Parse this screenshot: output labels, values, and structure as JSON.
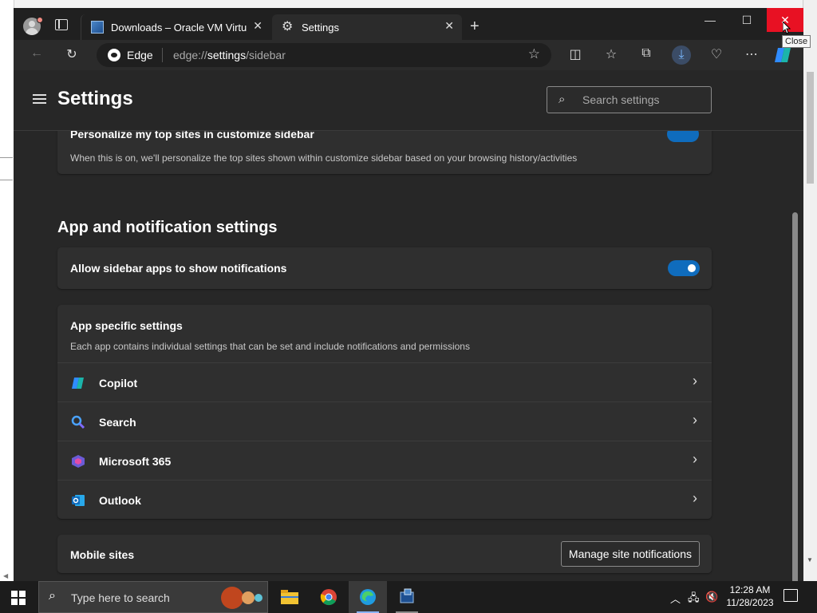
{
  "browser": {
    "tabs": [
      {
        "label": "Downloads – Oracle VM VirtualBox",
        "close": "✕"
      },
      {
        "label": "Settings",
        "close": "✕"
      }
    ],
    "new_tab": "+",
    "window": {
      "minimize": "—",
      "maximize": "☐",
      "close": "✕",
      "close_tooltip": "Close"
    },
    "address": {
      "site_label": "Edge",
      "url_prefix": "edge://",
      "url_main": "settings",
      "url_suffix": "/sidebar"
    }
  },
  "settings": {
    "title": "Settings",
    "search_placeholder": "Search settings",
    "partial_card": {
      "title": "Personalize my top sites in customize sidebar",
      "description": "When this is on, we'll personalize the top sites shown within customize sidebar based on your browsing history/activities"
    },
    "section_title": "App and notification settings",
    "notifications_toggle": {
      "label": "Allow sidebar apps to show notifications",
      "on": true
    },
    "app_specific": {
      "title": "App specific settings",
      "description": "Each app contains individual settings that can be set and include notifications and permissions",
      "apps": [
        {
          "label": "Copilot",
          "icon": "copilot-icon"
        },
        {
          "label": "Search",
          "icon": "search-icon"
        },
        {
          "label": "Microsoft 365",
          "icon": "microsoft-365-icon"
        },
        {
          "label": "Outlook",
          "icon": "outlook-icon"
        }
      ]
    },
    "mobile_sites": {
      "label": "Mobile sites",
      "button": "Manage site notifications"
    }
  },
  "taskbar": {
    "search_placeholder": "Type here to search",
    "time": "12:28 AM",
    "date": "11/28/2023"
  },
  "colors": {
    "accent": "#0f6cbd",
    "close_red": "#e81123",
    "page_bg": "#272727",
    "card_bg": "#2f2f2f"
  }
}
